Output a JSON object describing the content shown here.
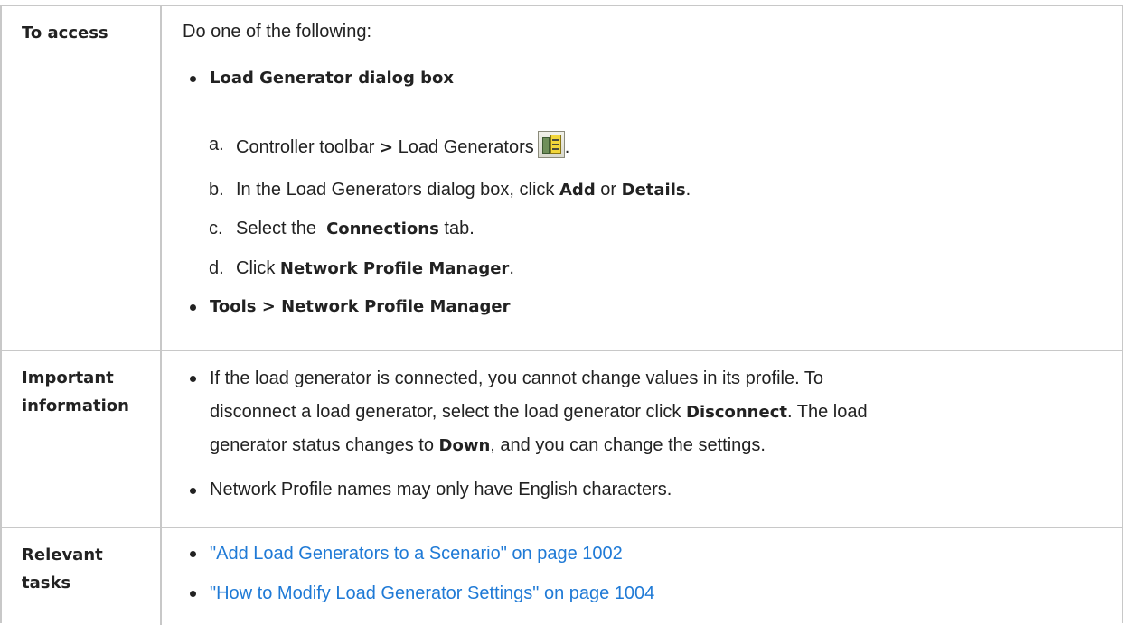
{
  "rows": {
    "access": {
      "label": "To access",
      "intro": "Do one of the following:",
      "option1": "Load Generator dialog box",
      "steps": {
        "a": {
          "letter": "a.",
          "text1": "Controller toolbar",
          "sep": ">",
          "text2": "Load Generators",
          "end": "."
        },
        "b": {
          "letter": "b.",
          "text1": "In the Load Generators dialog box, click",
          "bold1": "Add",
          "or": "or",
          "bold2": "Details",
          "end": "."
        },
        "c": {
          "letter": "c.",
          "text1": "Select the",
          "bold1": "Connections",
          "text2": "tab."
        },
        "d": {
          "letter": "d.",
          "text1": "Click",
          "bold1": "Network Profile Manager",
          "end": "."
        }
      },
      "option2": "Tools > Network Profile Manager",
      "icon": "load-generators-icon"
    },
    "important": {
      "label_line1": "Important",
      "label_line2": "information",
      "bullet1": {
        "line1": "If the load generator is connected, you cannot change values in its profile. To",
        "line2a": "disconnect a load generator, select the load generator click",
        "line2b": "Disconnect",
        "line2c": ". The load",
        "line3a": "generator status changes to",
        "line3b": "Down",
        "line3c": ", and you can change the settings."
      },
      "bullet2": "Network Profile names may only have English characters."
    },
    "tasks": {
      "label_line1": "Relevant",
      "label_line2": "tasks",
      "link1": "\"Add Load Generators to a Scenario\" on page 1002",
      "link2": "\"How to Modify Load Generator Settings\" on page 1004"
    }
  },
  "colors": {
    "link": "#1f7ad6",
    "border": "#c8c8c8",
    "text": "#222222"
  }
}
